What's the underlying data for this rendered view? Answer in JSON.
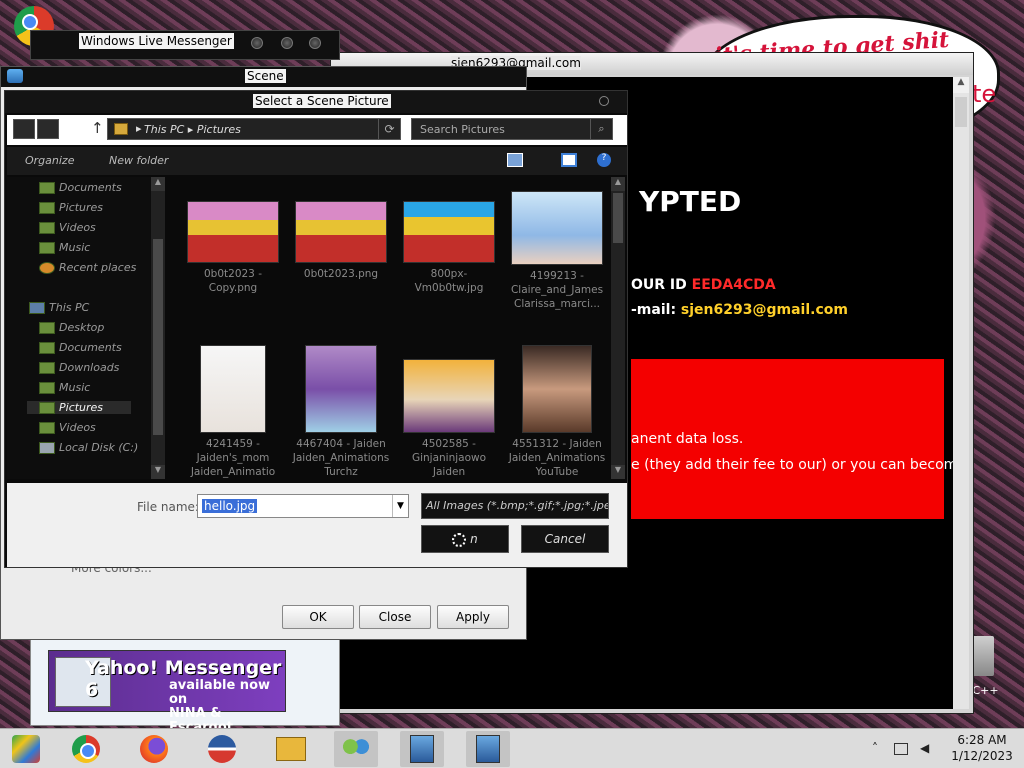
{
  "messenger": {
    "title": "Windows Live Messenger"
  },
  "ransom": {
    "title": "sjen6293@gmail.com",
    "heading": "YPTED",
    "id_label": "OUR ID",
    "id_value": "EEDA4CDA",
    "mail_label": "-mail:",
    "mail_value": "sjen6293@gmail.com",
    "line1": "anent data loss.",
    "line2": "e (they add their fee to our) or you can become"
  },
  "cloud": {
    "text": "it's time to get shit",
    "fragment": "te"
  },
  "scene": {
    "title": "Scene",
    "more_colors": "More colors...",
    "buttons": {
      "ok": "OK",
      "close": "Close",
      "apply": "Apply"
    }
  },
  "file_dialog": {
    "title": "Select a Scene Picture",
    "address": {
      "this_pc": "This PC",
      "pictures": "Pictures",
      "separator": "▸"
    },
    "search_placeholder": "Search Pictures",
    "toolbar": {
      "organize": "Organize",
      "new_folder": "New folder"
    },
    "nav_items": [
      {
        "label": "Documents"
      },
      {
        "label": "Pictures"
      },
      {
        "label": "Videos"
      },
      {
        "label": "Music"
      },
      {
        "label": "Recent places"
      },
      {
        "label": "This PC"
      },
      {
        "label": "Desktop"
      },
      {
        "label": "Documents"
      },
      {
        "label": "Downloads"
      },
      {
        "label": "Music"
      },
      {
        "label": "Pictures"
      },
      {
        "label": "Videos"
      },
      {
        "label": "Local Disk (C:)"
      }
    ],
    "files": [
      {
        "name": "0b0t2023 - Copy.png"
      },
      {
        "name": "0b0t2023.png"
      },
      {
        "name": "800px-Vm0b0tw.jpg"
      },
      {
        "name": "4199213 - Claire_and_James Clarissa_marci..."
      },
      {
        "name": "4241459 - Jaiden's_mom Jaiden_Animatio"
      },
      {
        "name": "4467404 - Jaiden Jaiden_Animations Turchz"
      },
      {
        "name": "4502585 - Ginjaninjaowo Jaiden"
      },
      {
        "name": "4551312 - Jaiden Jaiden_Animations YouTube"
      }
    ],
    "file_name_label": "File name:",
    "file_name_value": "hello.jpg",
    "filter": "All Images (*.bmp;*.gif;*.jpg;*.jpe",
    "open_label": "n",
    "cancel_label": "Cancel"
  },
  "ad": {
    "brand": "Yahoo! Messenger 6",
    "line1": "available now on",
    "line2": "NINA & Escargot"
  },
  "desktop_fragment": "n C++",
  "taskbar": {
    "apps": [
      "chrome-icon",
      "firefox-icon",
      "obama-logo-icon",
      "file-explorer-icon",
      "messenger-icon",
      "setup-icon",
      "setup-icon"
    ],
    "clock_time": "6:28 AM",
    "clock_date": "1/12/2023",
    "tray_icons": [
      "chevron-up-icon",
      "network-icon",
      "speaker-icon"
    ]
  }
}
